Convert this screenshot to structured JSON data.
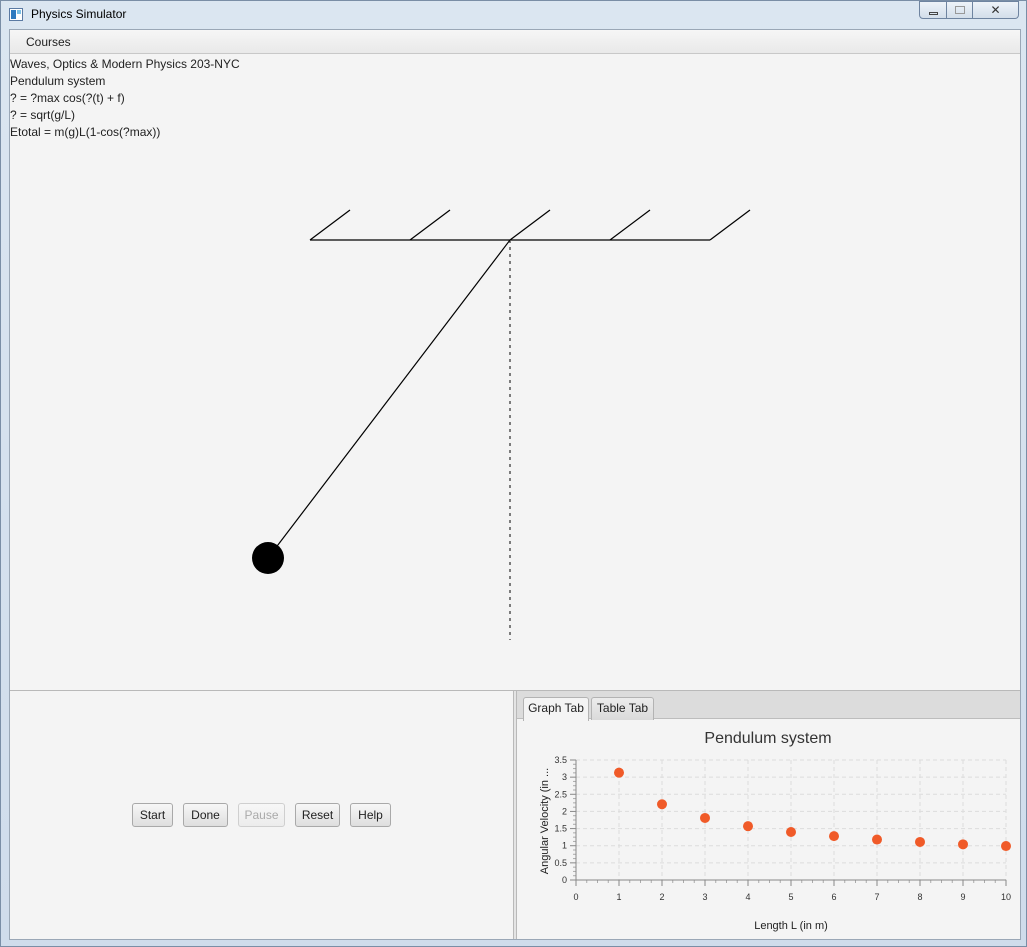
{
  "window": {
    "title": "Physics Simulator",
    "controls": {
      "minimize": "minimize-icon",
      "maximize": "maximize-icon",
      "close": "close-icon"
    }
  },
  "menu": {
    "items": [
      "Courses"
    ]
  },
  "info": {
    "course": "Waves, Optics & Modern Physics 203-NYC",
    "system": "Pendulum system",
    "equations": [
      "? = ?max cos(?(t) + f)",
      "? = sqrt(g/L)",
      "Etotal = m(g)L(1-cos(?max))"
    ]
  },
  "simulation": {
    "bob_color": "#000000",
    "string_color": "#000000",
    "guide_line_color": "#555555"
  },
  "controls": {
    "start": "Start",
    "done": "Done",
    "pause": "Pause",
    "reset": "Reset",
    "help": "Help",
    "pause_enabled": false
  },
  "tabs": {
    "items": [
      "Graph Tab",
      "Table Tab"
    ],
    "active": 0
  },
  "chart_data": {
    "type": "scatter",
    "title": "Pendulum system",
    "xlabel": "Length L (in m)",
    "ylabel": "Angular Velocity (in ...",
    "xlim": [
      0,
      10
    ],
    "ylim": [
      0,
      3.5
    ],
    "x_ticks": [
      "0",
      "1",
      "2",
      "3",
      "4",
      "5",
      "6",
      "7",
      "8",
      "9",
      "10"
    ],
    "y_ticks": [
      "0",
      "0.5",
      "1",
      "1.5",
      "2",
      "2.5",
      "3",
      "3.5"
    ],
    "grid": true,
    "color": "#f05a28",
    "series": [
      {
        "x": [
          1,
          2,
          3,
          4,
          5,
          6,
          7,
          8,
          9,
          10
        ],
        "y": [
          3.13,
          2.21,
          1.81,
          1.57,
          1.4,
          1.28,
          1.18,
          1.11,
          1.04,
          0.99
        ]
      }
    ]
  }
}
